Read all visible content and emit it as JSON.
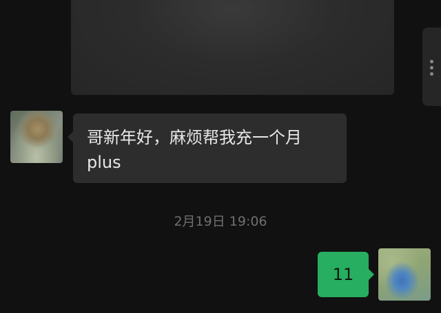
{
  "chat": {
    "incoming_message": {
      "text": "哥新年好，麻烦帮我充一个月plus"
    },
    "timestamp": "2月19日 19:06",
    "outgoing_message": {
      "text": "11"
    }
  },
  "colors": {
    "background": "#111111",
    "incoming_bubble": "#2d2d2d",
    "outgoing_bubble": "#27ae60",
    "timestamp_text": "#6f6f6f"
  },
  "icons": {
    "side_handle": "more-vertical-icon"
  }
}
